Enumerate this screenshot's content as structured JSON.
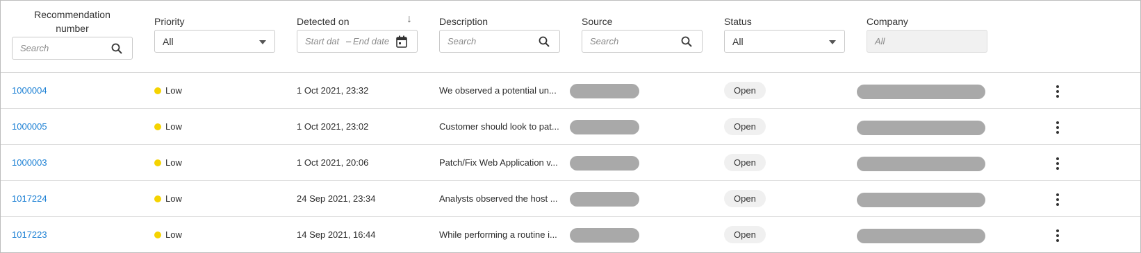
{
  "columns": {
    "recommendation": {
      "title_line1": "Recommendation",
      "title_line2": "number",
      "placeholder": "Search"
    },
    "priority": {
      "title": "Priority",
      "selected": "All"
    },
    "detected": {
      "title": "Detected on",
      "sort_arrow": "↓",
      "start_placeholder": "Start dat",
      "dash": "–",
      "end_placeholder": "End date"
    },
    "description": {
      "title": "Description",
      "placeholder": "Search"
    },
    "source": {
      "title": "Source",
      "placeholder": "Search"
    },
    "status": {
      "title": "Status",
      "selected": "All"
    },
    "company": {
      "title": "Company",
      "placeholder": "All"
    }
  },
  "colors": {
    "link": "#1a7fd4",
    "priority_low": "#f5d300",
    "redaction": "#a9a9a9",
    "status_pill_bg": "#f0f0f0"
  },
  "rows": [
    {
      "number": "1000004",
      "priority": "Low",
      "detected": "1 Oct 2021, 23:32",
      "description": "We observed a potential un...",
      "status": "Open"
    },
    {
      "number": "1000005",
      "priority": "Low",
      "detected": "1 Oct 2021, 23:02",
      "description": "Customer should look to pat...",
      "status": "Open"
    },
    {
      "number": "1000003",
      "priority": "Low",
      "detected": "1 Oct 2021, 20:06",
      "description": "Patch/Fix Web Application v...",
      "status": "Open"
    },
    {
      "number": "1017224",
      "priority": "Low",
      "detected": "24 Sep 2021, 23:34",
      "description": "Analysts observed the host ...",
      "status": "Open"
    },
    {
      "number": "1017223",
      "priority": "Low",
      "detected": "14 Sep 2021, 16:44",
      "description": "While performing a routine i...",
      "status": "Open"
    }
  ]
}
